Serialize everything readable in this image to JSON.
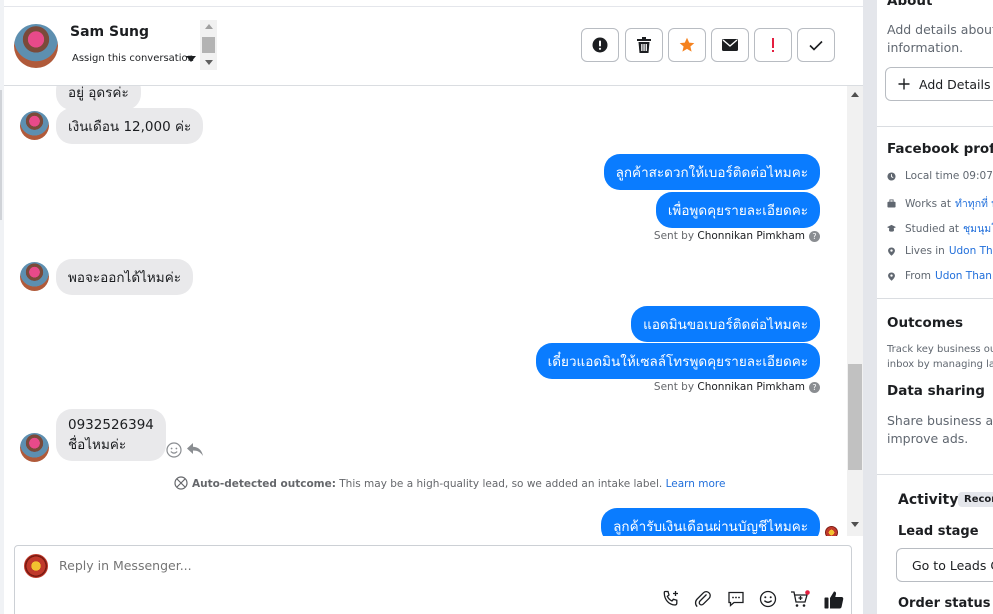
{
  "header": {
    "contact_name": "Sam Sung",
    "assign_label": "Assign this conversation",
    "buttons": [
      "mark-spam",
      "delete",
      "star",
      "mark-unread",
      "important",
      "done"
    ]
  },
  "messages": [
    {
      "dir": "in",
      "text": "อยู่ อุดรค่ะ"
    },
    {
      "dir": "in",
      "text": "เงินเดือน 12,000 ค่ะ"
    },
    {
      "dir": "out",
      "text": "ลูกค้าสะดวกให้เบอร์ติดต่อไหมคะ"
    },
    {
      "dir": "out",
      "text": "เพื่อพูดคุยรายละเอียดคะ"
    },
    {
      "sent_by_prefix": "Sent by",
      "sent_by_name": "Chonnikan Pimkham"
    },
    {
      "dir": "in",
      "text": "พอจะออกได้ไหมค่ะ"
    },
    {
      "dir": "out",
      "text": "แอดมินขอเบอร์ติดต่อไหมคะ"
    },
    {
      "dir": "out",
      "text": "เดี๋ยวแอดมินให้เซลล์โทรพูดคุยรายละเอียดคะ"
    },
    {
      "sent_by_prefix": "Sent by",
      "sent_by_name": "Chonnikan Pimkham"
    },
    {
      "dir": "in",
      "line1": "0932526394",
      "line2": "ชื่อไหมค่ะ"
    },
    {
      "dir": "out",
      "text": "ลูกค้ารับเงินเดือนผ่านบัญชีไหมคะ"
    }
  ],
  "auto_detect": {
    "bold": "Auto-detected outcome:",
    "text": " This may be a high-quality lead, so we added an intake label.",
    "link": "Learn more"
  },
  "composer": {
    "placeholder": "Reply in Messenger..."
  },
  "panel": {
    "about_title": "About",
    "about_text1": "Add details about p",
    "about_text2": "information.",
    "add_details": "Add Details",
    "fb_title": "Facebook profil",
    "local_time_label": "Local time",
    "local_time": "09:07",
    "works_label": "Works at",
    "works": "ทำทุกที่ ท",
    "studied_label": "Studied at",
    "studied": "ชุมนุมโร",
    "lives_label": "Lives in",
    "lives": "Udon Thani",
    "from_label": "From",
    "from": "Udon Thani",
    "outcomes_title": "Outcomes",
    "outcomes_text1": "Track key business out",
    "outcomes_text2": "inbox by managing lab",
    "sharing_title": "Data sharing",
    "sharing_text1": "Share business activ",
    "sharing_text2": "improve ads.",
    "activity_title": "Activity",
    "activity_badge": "Recor",
    "lead_stage_title": "Lead stage",
    "leads_button": "Go to Leads C",
    "order_status_title": "Order status"
  },
  "colors": {
    "outgoing_bubble": "#0a7cff",
    "incoming_bubble": "#e9e9eb",
    "star": "#f5821f",
    "important": "#e41e3f",
    "link": "#216fdb"
  }
}
